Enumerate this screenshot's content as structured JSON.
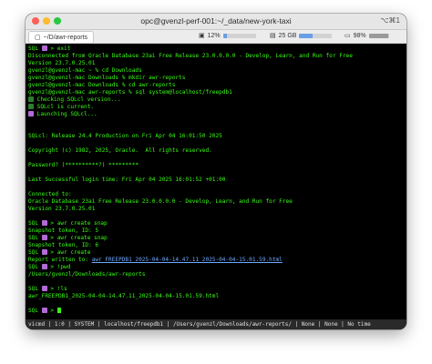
{
  "window": {
    "title": "opc@gvenzl-perf-001:~/_data/new-york-taxi",
    "shortcut": "⌥⌘1"
  },
  "statusbar": {
    "tab_label": "~/D/awr-reports",
    "cpu": {
      "icon": "cpu-icon",
      "value": "12%",
      "fill_percent": 12
    },
    "memory": {
      "icon": "memory-icon",
      "value": "25 GB",
      "fill_percent": 40
    },
    "battery": {
      "icon": "battery-icon",
      "value": "98%",
      "fill_percent": 98
    }
  },
  "terminal": {
    "lines": [
      [
        {
          "t": "SQL "
        },
        {
          "emoji": "rocket"
        },
        {
          "t": " > exit"
        }
      ],
      [
        {
          "t": "Disconnected from Oracle Database 23ai Free Release 23.0.0.0.0 - Develop, Learn, and Run for Free"
        }
      ],
      [
        {
          "t": "Version 23.7.0.25.01"
        }
      ],
      [
        {
          "t": "gvenzl@gvenzl-mac ~ % cd Downloads"
        }
      ],
      [
        {
          "t": "gvenzl@gvenzl-mac Downloads % mkdir awr-reports"
        }
      ],
      [
        {
          "t": "gvenzl@gvenzl-mac Downloads % cd awr-reports"
        }
      ],
      [
        {
          "t": "gvenzl@gvenzl-mac awr-reports % sql system@localhost/freepdb1"
        }
      ],
      [
        {
          "emoji": "check"
        },
        {
          "t": " Checking SQLcl version..."
        }
      ],
      [
        {
          "emoji": "check"
        },
        {
          "t": " SQLcl is current."
        }
      ],
      [
        {
          "emoji": "rocket"
        },
        {
          "t": " Launching SQLcl..."
        }
      ],
      [],
      [],
      [
        {
          "t": "SQLcl: Release 24.4 Production on Fri Apr 04 16:01:50 2025"
        }
      ],
      [],
      [
        {
          "t": "Copyright (c) 1982, 2025, Oracle.  All rights reserved."
        }
      ],
      [],
      [
        {
          "t": "Password? (**********?) *********"
        }
      ],
      [],
      [
        {
          "t": "Last Successful login time: Fri Apr 04 2025 16:01:52 +01:00"
        }
      ],
      [],
      [
        {
          "t": "Connected to:"
        }
      ],
      [
        {
          "t": "Oracle Database 23ai Free Release 23.0.0.0.0 - Develop, Learn, and Run for Free"
        }
      ],
      [
        {
          "t": "Version 23.7.0.25.01"
        }
      ],
      [],
      [
        {
          "t": "SQL "
        },
        {
          "emoji": "rocket"
        },
        {
          "t": " > awr create snap"
        }
      ],
      [
        {
          "t": "Snapshot token, ID: 5"
        }
      ],
      [
        {
          "t": "SQL "
        },
        {
          "emoji": "rocket"
        },
        {
          "t": " > awr create snap"
        }
      ],
      [
        {
          "t": "Snapshot token, ID: 6"
        }
      ],
      [
        {
          "t": "SQL "
        },
        {
          "emoji": "rocket"
        },
        {
          "t": " > awr create"
        }
      ],
      [
        {
          "t": "Report written to: "
        },
        {
          "u": "awr_FREEPDB1_2025-04-04-14.47.11_2025-04-04-15.01.59.html"
        }
      ],
      [
        {
          "t": "SQL "
        },
        {
          "emoji": "rocket"
        },
        {
          "t": " > !pwd"
        }
      ],
      [
        {
          "t": "/Users/gvenzl/Downloads/awr-reports"
        }
      ],
      [],
      [
        {
          "t": "SQL "
        },
        {
          "emoji": "rocket"
        },
        {
          "t": " > !ls"
        }
      ],
      [
        {
          "t": "awr_FREEPDB1_2025-04-04-14.47.11_2025-04-04-15.01.59.html"
        }
      ],
      [],
      [
        {
          "t": "SQL "
        },
        {
          "emoji": "rocket"
        },
        {
          "t": " > "
        },
        {
          "cursor": true
        }
      ]
    ],
    "bottom_status": "vicmd | 1:0 | SYSTEM | localhost/freepdb1 | /Users/gvenzl/Downloads/awr-reports/ | None | None | No time"
  },
  "colors": {
    "prompt_text": "#39ff14",
    "link": "#6fa8ff",
    "background": "#000000"
  }
}
